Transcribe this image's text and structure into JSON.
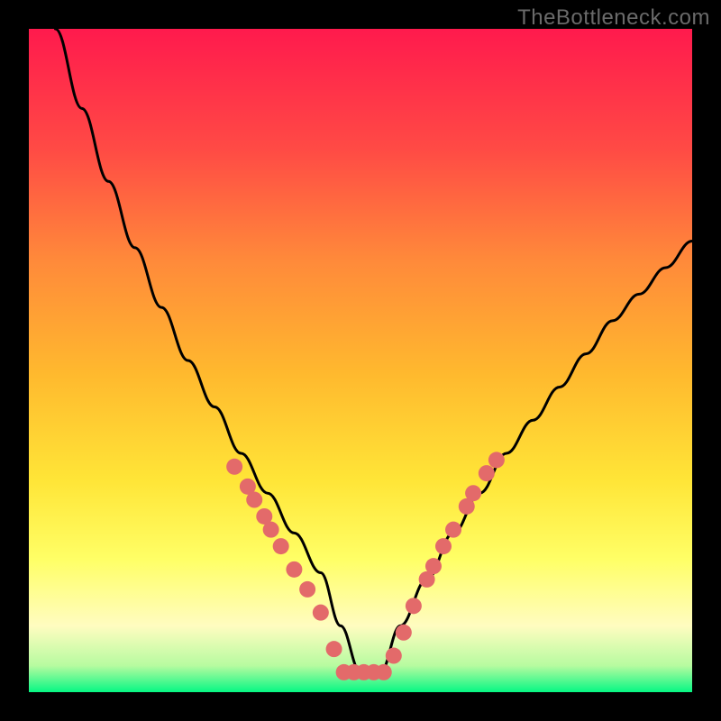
{
  "watermark": "TheBottleneck.com",
  "chart_data": {
    "type": "line",
    "title": "",
    "xlabel": "",
    "ylabel": "",
    "xlim": [
      0,
      100
    ],
    "ylim": [
      0,
      100
    ],
    "grid": false,
    "legend": false,
    "background_gradient": [
      "#ff1a4d",
      "#ff6a3a",
      "#ffb92e",
      "#ffe537",
      "#ffff66",
      "#fffcc0",
      "#06f784"
    ],
    "series": [
      {
        "name": "bottleneck-curve",
        "x": [
          4,
          8,
          12,
          16,
          20,
          24,
          28,
          32,
          36,
          40,
          44,
          47,
          50,
          53,
          56,
          60,
          64,
          68,
          72,
          76,
          80,
          84,
          88,
          92,
          96,
          100
        ],
        "y": [
          100,
          88,
          77,
          67,
          58,
          50,
          43,
          36,
          30,
          24,
          18,
          10,
          3,
          3,
          10,
          17,
          24,
          30,
          36,
          41,
          46,
          51,
          56,
          60,
          64,
          68
        ]
      }
    ],
    "markers": {
      "name": "data-points",
      "color": "#e36a6a",
      "points": [
        {
          "x": 31.0,
          "y": 34.0
        },
        {
          "x": 33.0,
          "y": 31.0
        },
        {
          "x": 34.0,
          "y": 29.0
        },
        {
          "x": 35.5,
          "y": 26.5
        },
        {
          "x": 36.5,
          "y": 24.5
        },
        {
          "x": 38.0,
          "y": 22.0
        },
        {
          "x": 40.0,
          "y": 18.5
        },
        {
          "x": 42.0,
          "y": 15.5
        },
        {
          "x": 44.0,
          "y": 12.0
        },
        {
          "x": 46.0,
          "y": 6.5
        },
        {
          "x": 47.5,
          "y": 3.0
        },
        {
          "x": 49.0,
          "y": 3.0
        },
        {
          "x": 50.5,
          "y": 3.0
        },
        {
          "x": 52.0,
          "y": 3.0
        },
        {
          "x": 53.5,
          "y": 3.0
        },
        {
          "x": 55.0,
          "y": 5.5
        },
        {
          "x": 56.5,
          "y": 9.0
        },
        {
          "x": 58.0,
          "y": 13.0
        },
        {
          "x": 60.0,
          "y": 17.0
        },
        {
          "x": 61.0,
          "y": 19.0
        },
        {
          "x": 62.5,
          "y": 22.0
        },
        {
          "x": 64.0,
          "y": 24.5
        },
        {
          "x": 66.0,
          "y": 28.0
        },
        {
          "x": 67.0,
          "y": 30.0
        },
        {
          "x": 69.0,
          "y": 33.0
        },
        {
          "x": 70.5,
          "y": 35.0
        }
      ]
    }
  }
}
